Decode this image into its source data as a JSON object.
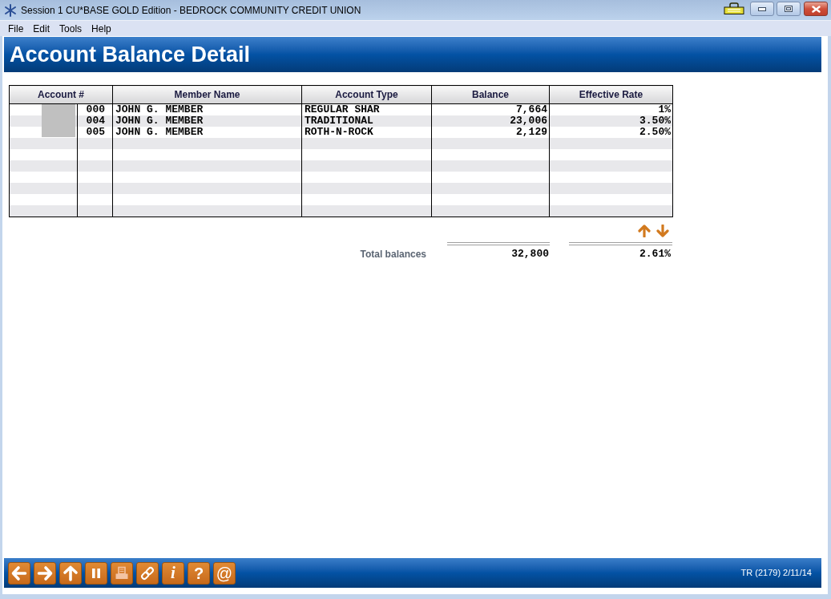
{
  "window": {
    "title": "Session 1 CU*BASE GOLD Edition - BEDROCK COMMUNITY CREDIT UNION"
  },
  "menu": [
    "File",
    "Edit",
    "Tools",
    "Help"
  ],
  "header": {
    "title": "Account Balance Detail"
  },
  "table": {
    "columns": [
      "Account #",
      "Member Name",
      "Account Type",
      "Balance",
      "Effective Rate"
    ],
    "rows": [
      {
        "account_suffix": "000",
        "member_name": "JOHN G. MEMBER",
        "account_type": "REGULAR SHAR",
        "balance": "7,664",
        "effective_rate": "1%"
      },
      {
        "account_suffix": "004",
        "member_name": "JOHN G. MEMBER",
        "account_type": "TRADITIONAL",
        "balance": "23,006",
        "effective_rate": "3.50%"
      },
      {
        "account_suffix": "005",
        "member_name": "JOHN G. MEMBER",
        "account_type": "ROTH-N-ROCK",
        "balance": "2,129",
        "effective_rate": "2.50%"
      }
    ]
  },
  "totals": {
    "label": "Total balances",
    "balance": "32,800",
    "effective_rate": "2.61%"
  },
  "toolbar": [
    {
      "kind": "back",
      "disabled": false
    },
    {
      "kind": "forward",
      "disabled": false
    },
    {
      "kind": "up",
      "disabled": false
    },
    {
      "kind": "pause",
      "disabled": false
    },
    {
      "kind": "print",
      "disabled": true
    },
    {
      "kind": "link",
      "disabled": false
    },
    {
      "kind": "info",
      "label": "i",
      "disabled": false
    },
    {
      "kind": "help",
      "label": "?",
      "disabled": false
    },
    {
      "kind": "email",
      "label": "@",
      "disabled": false
    }
  ],
  "status_bar": {
    "text": "TR (2179) 2/11/14"
  }
}
